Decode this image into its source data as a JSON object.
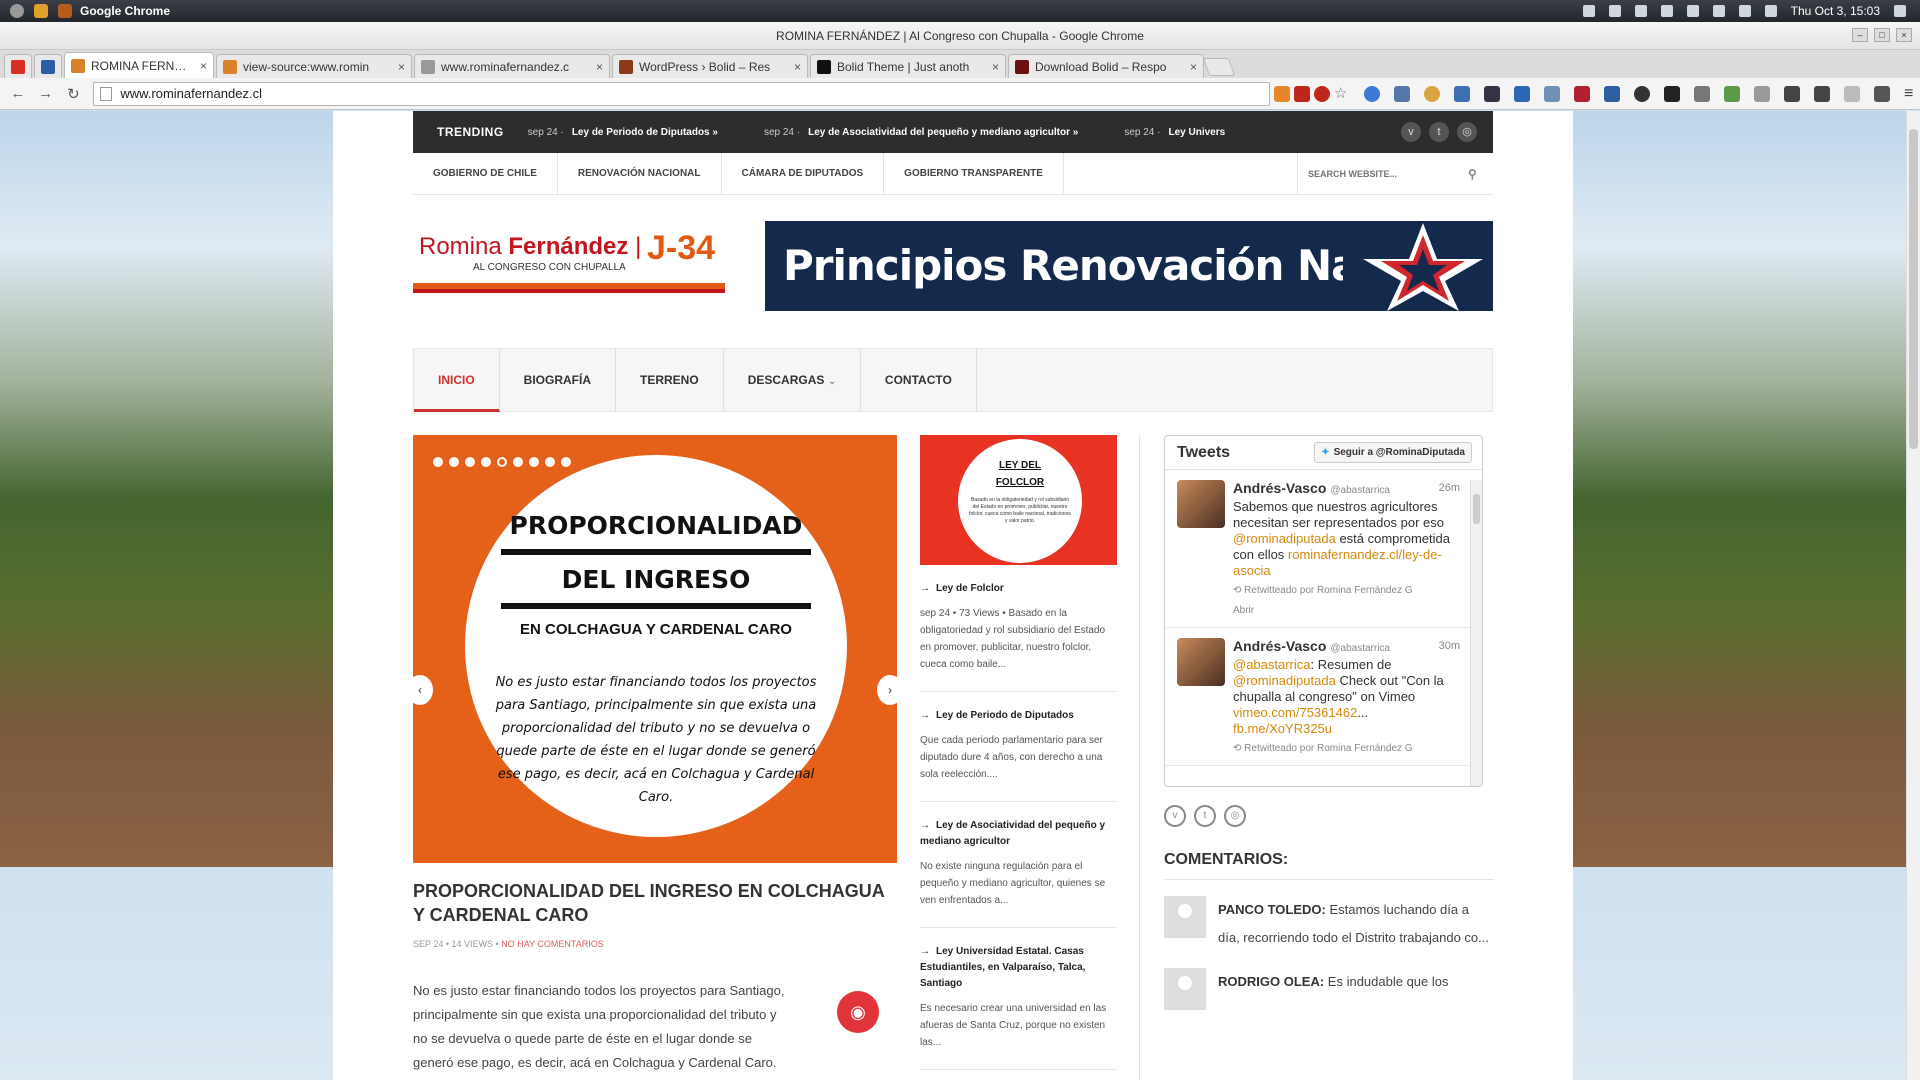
{
  "system_bar": {
    "app_name": "Google Chrome",
    "datetime": "Thu Oct 3, 15:03"
  },
  "window": {
    "title": "ROMINA FERNÁNDEZ | Al Congreso con Chupalla - Google Chrome"
  },
  "tabs": [
    {
      "label": "ROMINA FERNÁNDEZ | A",
      "active": true,
      "favicon_color": "#d9822b"
    },
    {
      "label": "view-source:www.romin",
      "active": false,
      "favicon_color": "#d9822b"
    },
    {
      "label": "www.rominafernandez.c",
      "active": false,
      "favicon_color": "#999999"
    },
    {
      "label": "WordPress › Bolid – Res",
      "active": false,
      "favicon_color": "#8b3a1a"
    },
    {
      "label": "Bolid Theme | Just anoth",
      "active": false,
      "favicon_color": "#111111"
    },
    {
      "label": "Download Bolid – Respo",
      "active": false,
      "favicon_color": "#6b1010"
    }
  ],
  "toolbar": {
    "url": "www.rominafernandez.cl",
    "back_icon": "←",
    "forward_icon": "→",
    "reload_icon": "↻"
  },
  "site": {
    "trending_label": "TRENDING",
    "trending": [
      {
        "date": "sep 24 ·",
        "title": "Ley de Periodo de Diputados »"
      },
      {
        "date": "sep 24 ·",
        "title": "Ley de Asociatividad del pequeño y mediano agricultor »"
      },
      {
        "date": "sep 24 ·",
        "title": "Ley Univers"
      }
    ],
    "top_nav": [
      "GOBIERNO DE CHILE",
      "RENOVACIÓN NACIONAL",
      "CÁMARA DE DIPUTADOS",
      "GOBIERNO TRANSPARENTE"
    ],
    "search_placeholder": "SEARCH WEBSITE...",
    "logo": {
      "name_first": "Romina",
      "name_last": "Fernández",
      "separator": "|",
      "tag": "J-34",
      "subtitle": "AL CONGRESO CON CHUPALLA"
    },
    "banner_text": "Principios Renovación Nacional",
    "main_nav": [
      {
        "label": "INICIO",
        "active": true
      },
      {
        "label": "BIOGRAFÍA",
        "active": false
      },
      {
        "label": "TERRENO",
        "active": false
      },
      {
        "label": "DESCARGAS",
        "active": false,
        "has_dropdown": true
      },
      {
        "label": "CONTACTO",
        "active": false
      }
    ],
    "slider": {
      "dot_count": 9,
      "active_dot": 5,
      "heading_line1": "PROPORCIONALIDAD",
      "heading_line2": "DEL INGRESO",
      "heading_line3": "EN COLCHAGUA Y CARDENAL CARO",
      "body": "No es justo estar financiando todos los proyectos para Santiago, principalmente sin que exista una proporcionalidad del tributo y no se devuelva o quede parte de éste en el lugar donde se generó ese pago, es decir, acá en Colchagua y Cardenal Caro.",
      "prev_icon": "‹",
      "next_icon": "›"
    },
    "featured_post": {
      "title": "PROPORCIONALIDAD DEL INGRESO EN COLCHAGUA Y CARDENAL CARO",
      "meta_date": "SEP 24",
      "meta_views": "14 VIEWS",
      "meta_comments": "NO HAY COMENTARIOS",
      "meta_sep": " • ",
      "excerpt": "No es justo estar financiando todos los proyectos para Santiago, principalmente sin que exista una proporcionalidad del tributo y no se devuelva o quede parte de éste en el lugar donde se generó ese pago, es decir, acá en Colchagua y Cardenal Caro."
    },
    "folclor_image": {
      "title_line1": "LEY DEL",
      "title_line2": "FOLCLOR",
      "small_text": "Basado en la obligatoriedad y rol subsidiario del Estado en promover, publicitar, nuestro folclor, cueca como baile nacional, tradiciones y valor patrio."
    },
    "mid_posts": [
      {
        "title": "Ley de Folclor",
        "desc": "sep 24 • 73 Views • Basado en la obligatoriedad y rol subsidiario del Estado en promover, publicitar, nuestro folclor, cueca como baile..."
      },
      {
        "title": "Ley de Periodo de Diputados",
        "desc": "Que cada periodo parlamentario para ser diputado dure 4 años, con derecho a una sola reelección...."
      },
      {
        "title": "Ley de Asociatividad del pequeño y mediano agricultor",
        "desc": "No existe ninguna regulación para el pequeño y mediano agricultor, quienes se ven enfrentados a..."
      },
      {
        "title": "Ley Universidad Estatal. Casas Estudiantiles, en Valparaíso, Talca, Santiago",
        "desc": "Es necesario crear una universidad en las afueras de Santa Cruz, porque no existen las..."
      }
    ],
    "tweets": {
      "title": "Tweets",
      "follow_label": "Seguir a @RominaDiputada",
      "items": [
        {
          "name": "Andrés-Vasco",
          "handle": "@abastarrica",
          "time": "26m",
          "text": "Sabemos que nuestros agricultores necesitan ser representados por eso ",
          "mention": "@rominadiputada",
          "text2": " está comprometida con ellos ",
          "link": "rominafernandez.cl/ley-de-asocia",
          "retweet": "Retwitteado por Romina Fernández G",
          "action": "Abrir"
        },
        {
          "name": "Andrés-Vasco",
          "handle": "@abastarrica",
          "time": "30m",
          "mention0": "@abastarrica",
          "text": ": Resumen de ",
          "mention": "@rominadiputada",
          "text2": " Check out \"Con la chupalla al congreso\" on Vimeo ",
          "link": "vimeo.com/75361462",
          "ellipsis": "...",
          "link2": "fb.me/XoYR325u",
          "retweet": "Retwitteado por Romina Fernández G"
        }
      ]
    },
    "comments_heading": "COMENTARIOS:",
    "comments": [
      {
        "name": "PANCO TOLEDO:",
        "text": "Estamos luchando día a día, recorriendo todo el Distrito trabajando co..."
      },
      {
        "name": "RODRIGO OLEA:",
        "text": "Es indudable que los"
      }
    ]
  }
}
